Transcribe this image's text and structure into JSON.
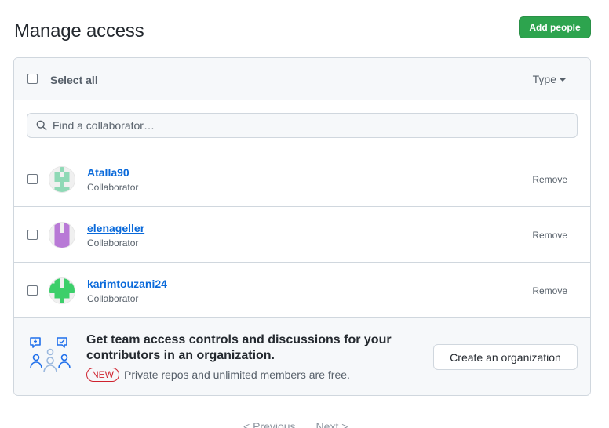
{
  "header": {
    "title": "Manage access",
    "add_button": "Add people"
  },
  "toolbar": {
    "select_all": "Select all",
    "type_label": "Type"
  },
  "search": {
    "placeholder": "Find a collaborator…"
  },
  "members": [
    {
      "name": "Atalla90",
      "role": "Collaborator",
      "remove": "Remove",
      "avatar_color": "#8fd9b6"
    },
    {
      "name": "elenageller",
      "role": "Collaborator",
      "remove": "Remove",
      "avatar_color": "#b879d6"
    },
    {
      "name": "karimtouzani24",
      "role": "Collaborator",
      "remove": "Remove",
      "avatar_color": "#3ccf6a"
    }
  ],
  "promo": {
    "title": "Get team access controls and discussions for your contributors in an organization.",
    "badge": "NEW",
    "subtitle": "Private repos and unlimited members are free.",
    "button": "Create an organization"
  },
  "pagination": {
    "previous": "< Previous",
    "next": "Next >"
  },
  "colors": {
    "accent": "#2da44e",
    "link": "#0969da",
    "new_badge": "#cf222e"
  }
}
